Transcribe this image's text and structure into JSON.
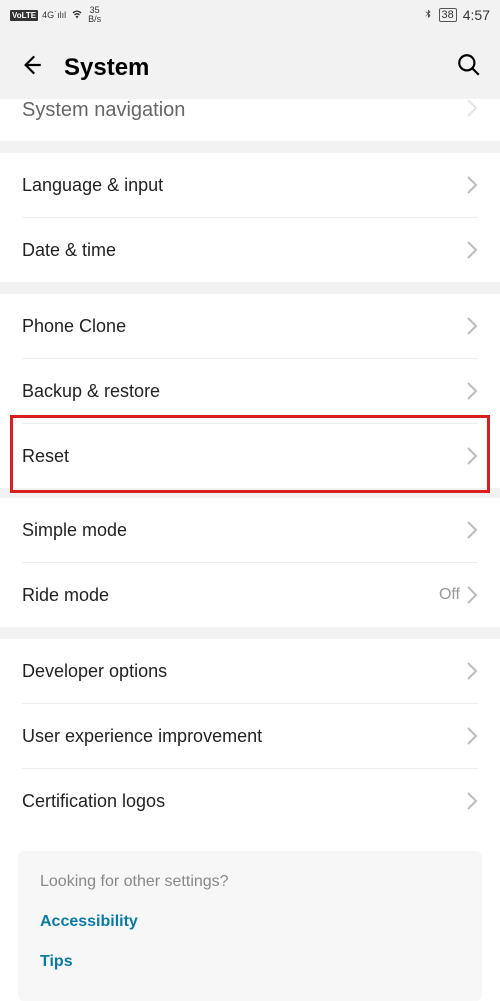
{
  "status": {
    "volte": "VoLTE",
    "sig": "4G",
    "speed_top": "35",
    "speed_bot": "B/s",
    "battery": "38",
    "time": "4:57"
  },
  "header": {
    "title": "System"
  },
  "items": {
    "partial": "System navigation",
    "language": "Language & input",
    "date": "Date & time",
    "clone": "Phone Clone",
    "backup": "Backup & restore",
    "reset": "Reset",
    "simple": "Simple mode",
    "ride": "Ride mode",
    "ride_value": "Off",
    "dev": "Developer options",
    "ux": "User experience improvement",
    "cert": "Certification logos"
  },
  "footer": {
    "heading": "Looking for other settings?",
    "link1": "Accessibility",
    "link2": "Tips"
  },
  "highlight": {
    "color": "#d81e1e"
  }
}
